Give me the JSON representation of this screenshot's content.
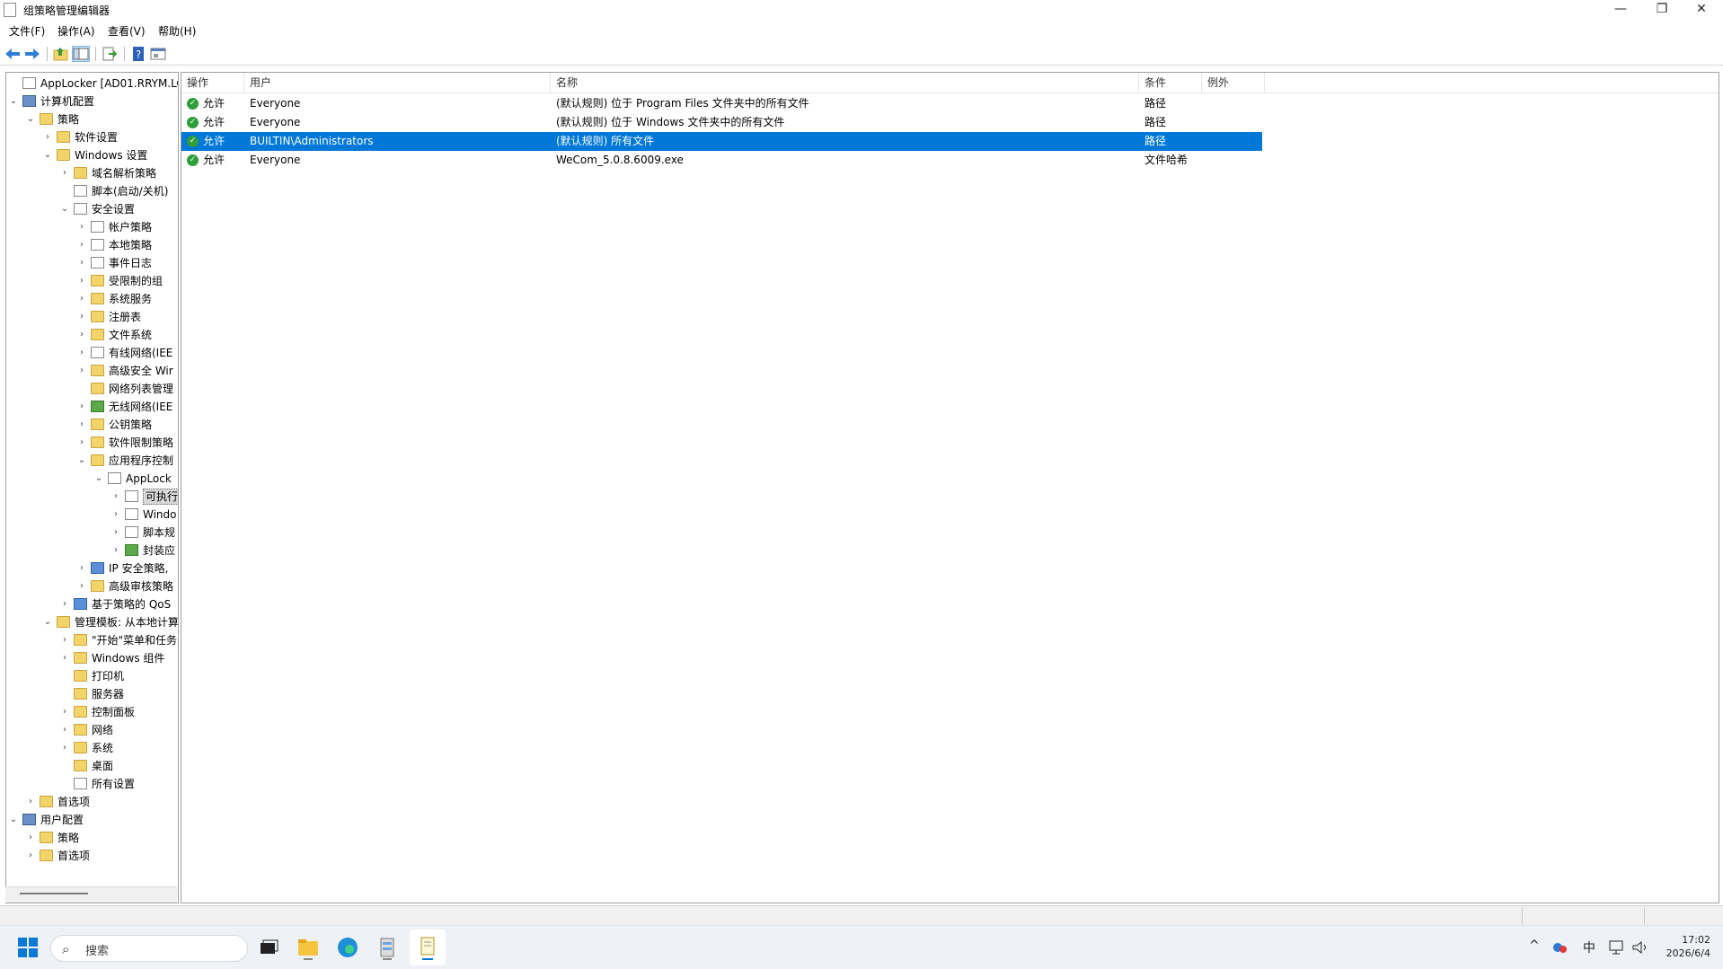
{
  "window": {
    "title": "组策略管理编辑器",
    "controls": {
      "minimize": "—",
      "maximize": "❐",
      "close": "✕"
    }
  },
  "menu": [
    "文件(F)",
    "操作(A)",
    "查看(V)",
    "帮助(H)"
  ],
  "toolbar": {
    "icons": [
      "back-arrow-icon",
      "forward-arrow-icon",
      "up-folder-icon",
      "show-hide-tree-icon",
      "export-list-icon",
      "help-icon",
      "properties-icon"
    ]
  },
  "tree": {
    "items": [
      {
        "label": "AppLocker [AD01.RRYM.LOC",
        "depth": 0,
        "chev": "",
        "icon": "policy"
      },
      {
        "label": "计算机配置",
        "depth": 0,
        "chev": "⌄",
        "icon": "computer"
      },
      {
        "label": "策略",
        "depth": 1,
        "chev": "⌄",
        "icon": "folder"
      },
      {
        "label": "软件设置",
        "depth": 2,
        "chev": "›",
        "icon": "folder"
      },
      {
        "label": "Windows 设置",
        "depth": 2,
        "chev": "⌄",
        "icon": "folder"
      },
      {
        "label": "域名解析策略",
        "depth": 3,
        "chev": "›",
        "icon": "folder"
      },
      {
        "label": "脚本(启动/关机)",
        "depth": 3,
        "chev": "",
        "icon": "doc"
      },
      {
        "label": "安全设置",
        "depth": 3,
        "chev": "⌄",
        "icon": "doc"
      },
      {
        "label": "帐户策略",
        "depth": 4,
        "chev": "›",
        "icon": "doc"
      },
      {
        "label": "本地策略",
        "depth": 4,
        "chev": "›",
        "icon": "doc"
      },
      {
        "label": "事件日志",
        "depth": 4,
        "chev": "›",
        "icon": "doc"
      },
      {
        "label": "受限制的组",
        "depth": 4,
        "chev": "›",
        "icon": "folder"
      },
      {
        "label": "系统服务",
        "depth": 4,
        "chev": "›",
        "icon": "folder"
      },
      {
        "label": "注册表",
        "depth": 4,
        "chev": "›",
        "icon": "folder"
      },
      {
        "label": "文件系统",
        "depth": 4,
        "chev": "›",
        "icon": "folder"
      },
      {
        "label": "有线网络(IEE",
        "depth": 4,
        "chev": "›",
        "icon": "doc"
      },
      {
        "label": "高级安全 Wir",
        "depth": 4,
        "chev": "›",
        "icon": "folder"
      },
      {
        "label": "网络列表管理",
        "depth": 4,
        "chev": "",
        "icon": "folder"
      },
      {
        "label": "无线网络(IEE",
        "depth": 4,
        "chev": "›",
        "icon": "green"
      },
      {
        "label": "公钥策略",
        "depth": 4,
        "chev": "›",
        "icon": "folder"
      },
      {
        "label": "软件限制策略",
        "depth": 4,
        "chev": "›",
        "icon": "folder"
      },
      {
        "label": "应用程序控制",
        "depth": 4,
        "chev": "⌄",
        "icon": "folder"
      },
      {
        "label": "AppLock",
        "depth": 5,
        "chev": "⌄",
        "icon": "doc"
      },
      {
        "label": "可执行",
        "depth": 6,
        "chev": "›",
        "icon": "doc",
        "selected": true
      },
      {
        "label": "Windo",
        "depth": 6,
        "chev": "›",
        "icon": "doc"
      },
      {
        "label": "脚本规",
        "depth": 6,
        "chev": "›",
        "icon": "doc"
      },
      {
        "label": "封装应",
        "depth": 6,
        "chev": "›",
        "icon": "green"
      },
      {
        "label": "IP 安全策略,",
        "depth": 4,
        "chev": "›",
        "icon": "blue"
      },
      {
        "label": "高级审核策略",
        "depth": 4,
        "chev": "›",
        "icon": "folder"
      },
      {
        "label": "基于策略的 QoS",
        "depth": 3,
        "chev": "›",
        "icon": "blue"
      },
      {
        "label": "管理模板: 从本地计算",
        "depth": 2,
        "chev": "⌄",
        "icon": "folder"
      },
      {
        "label": "\"开始\"菜单和任务",
        "depth": 3,
        "chev": "›",
        "icon": "folder"
      },
      {
        "label": "Windows 组件",
        "depth": 3,
        "chev": "›",
        "icon": "folder"
      },
      {
        "label": "打印机",
        "depth": 3,
        "chev": "",
        "icon": "folder"
      },
      {
        "label": "服务器",
        "depth": 3,
        "chev": "",
        "icon": "folder"
      },
      {
        "label": "控制面板",
        "depth": 3,
        "chev": "›",
        "icon": "folder"
      },
      {
        "label": "网络",
        "depth": 3,
        "chev": "›",
        "icon": "folder"
      },
      {
        "label": "系统",
        "depth": 3,
        "chev": "›",
        "icon": "folder"
      },
      {
        "label": "桌面",
        "depth": 3,
        "chev": "",
        "icon": "folder"
      },
      {
        "label": "所有设置",
        "depth": 3,
        "chev": "",
        "icon": "doc"
      },
      {
        "label": "首选项",
        "depth": 1,
        "chev": "›",
        "icon": "folder"
      },
      {
        "label": "用户配置",
        "depth": 0,
        "chev": "⌄",
        "icon": "computer"
      },
      {
        "label": "策略",
        "depth": 1,
        "chev": "›",
        "icon": "folder"
      },
      {
        "label": "首选项",
        "depth": 1,
        "chev": "›",
        "icon": "folder"
      }
    ]
  },
  "list": {
    "columns": [
      "操作",
      "用户",
      "名称",
      "条件",
      "例外"
    ],
    "rows": [
      {
        "action": "允许",
        "user": "Everyone",
        "name": "(默认规则) 位于 Program Files 文件夹中的所有文件",
        "condition": "路径",
        "exception": "",
        "selected": false
      },
      {
        "action": "允许",
        "user": "Everyone",
        "name": "(默认规则) 位于 Windows 文件夹中的所有文件",
        "condition": "路径",
        "exception": "",
        "selected": false
      },
      {
        "action": "允许",
        "user": "BUILTIN\\Administrators",
        "name": "(默认规则) 所有文件",
        "condition": "路径",
        "exception": "",
        "selected": true
      },
      {
        "action": "允许",
        "user": "Everyone",
        "name": "WeCom_5.0.8.6009.exe",
        "condition": "文件哈希",
        "exception": "",
        "selected": false
      }
    ]
  },
  "taskbar": {
    "search_placeholder": "搜索",
    "apps": [
      "task-view-icon",
      "file-explorer-icon",
      "edge-icon",
      "server-manager-icon",
      "gpo-editor-icon"
    ],
    "tray": {
      "chevron": "^",
      "ime": "中",
      "network": "▭",
      "volume": "🔊"
    },
    "time": "17:02",
    "date": "2026/6/4"
  },
  "colors": {
    "selection": "#0078d7",
    "allow_check": "#2e9e3a",
    "folder": "#f3d46b"
  }
}
